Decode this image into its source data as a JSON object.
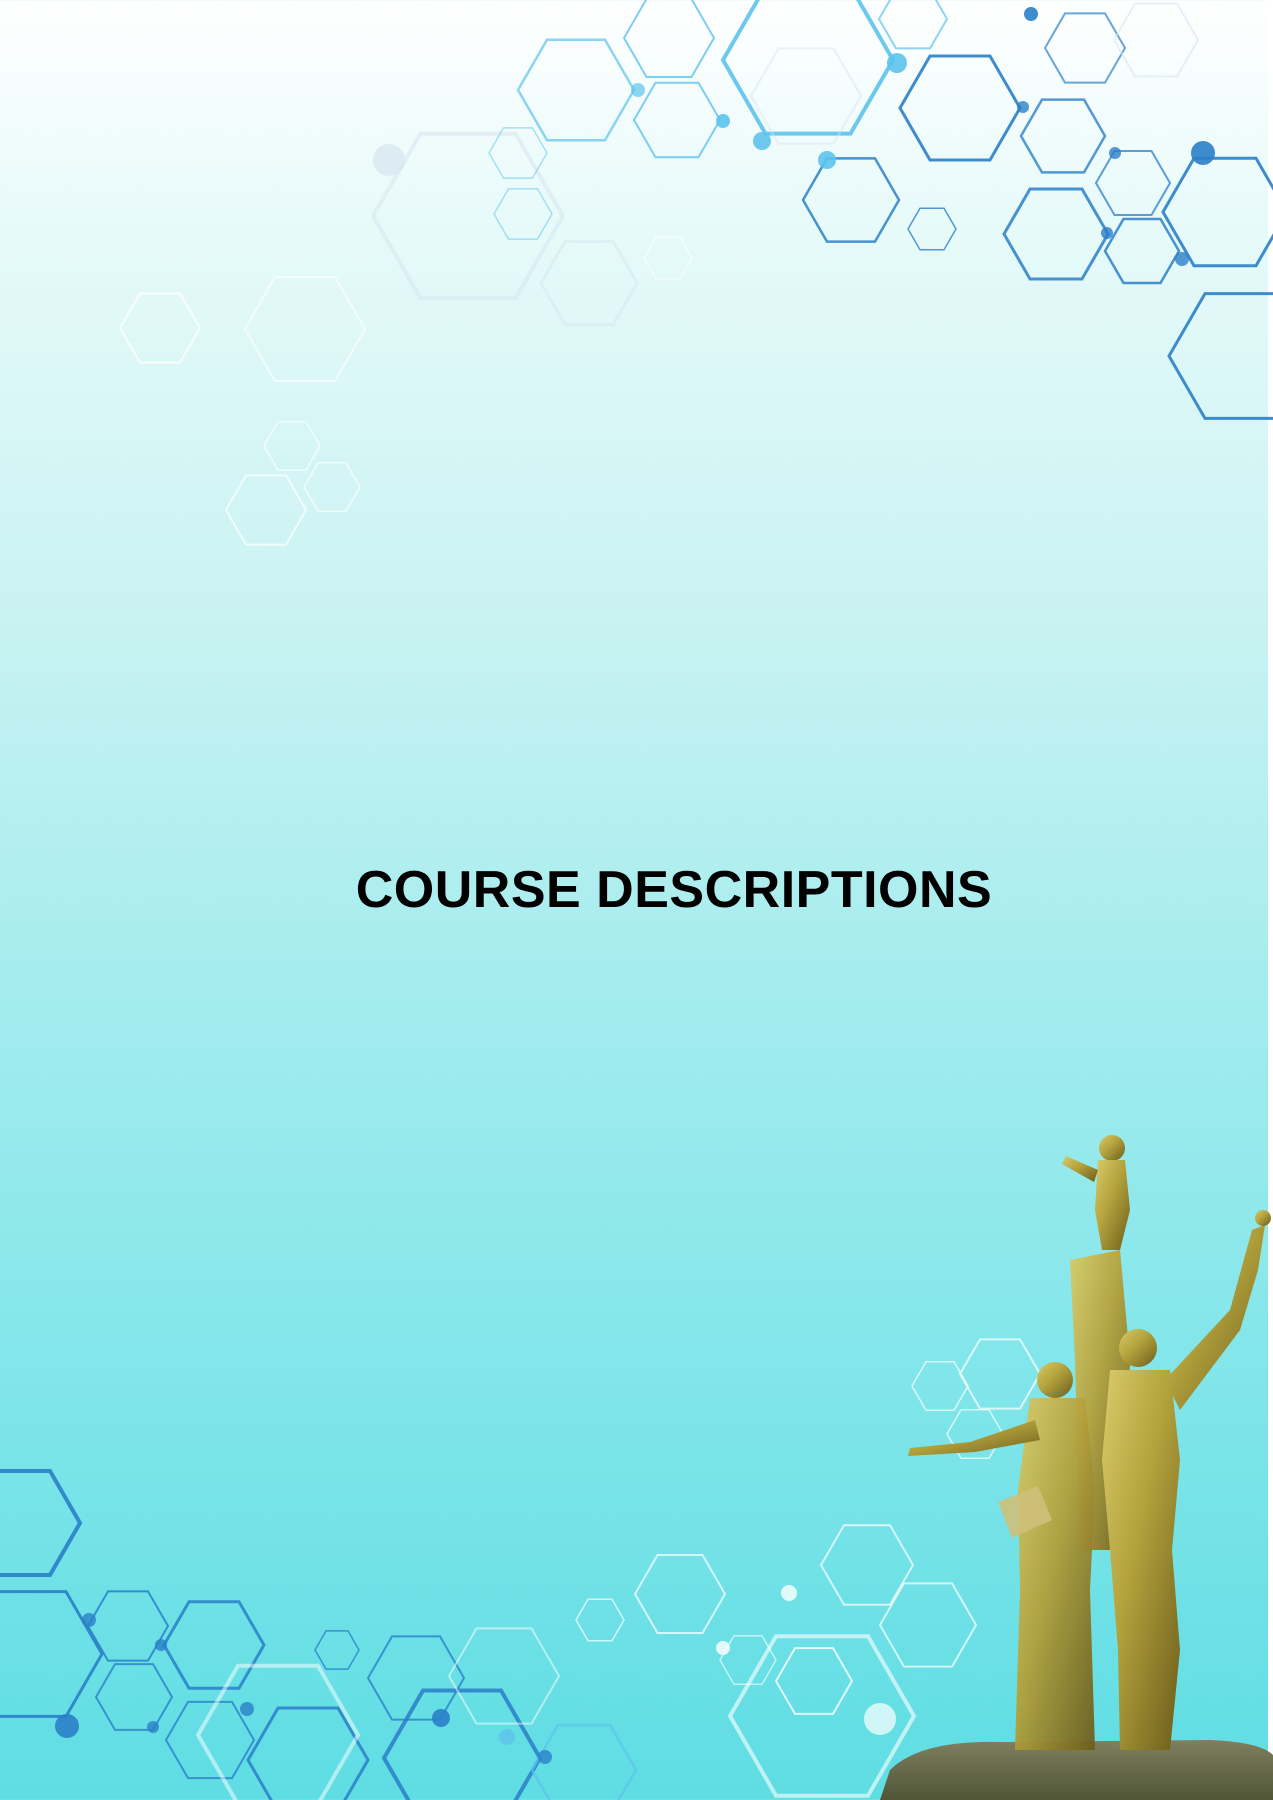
{
  "page": {
    "title": "COURSE DESCRIPTIONS"
  },
  "colors": {
    "background_top": "#ffffff",
    "background_bottom": "#5edde3",
    "hex_dark_blue": "#2a7fc8",
    "hex_light_blue": "#5cc3ec",
    "hex_faint": "#d6e6f0",
    "title_color": "#000000",
    "statue_gold": "#b8a944"
  },
  "decorations": {
    "top_pattern": "hexagon-network-icon",
    "bottom_pattern": "hexagon-network-icon",
    "monument": "golden-statue-monument"
  }
}
